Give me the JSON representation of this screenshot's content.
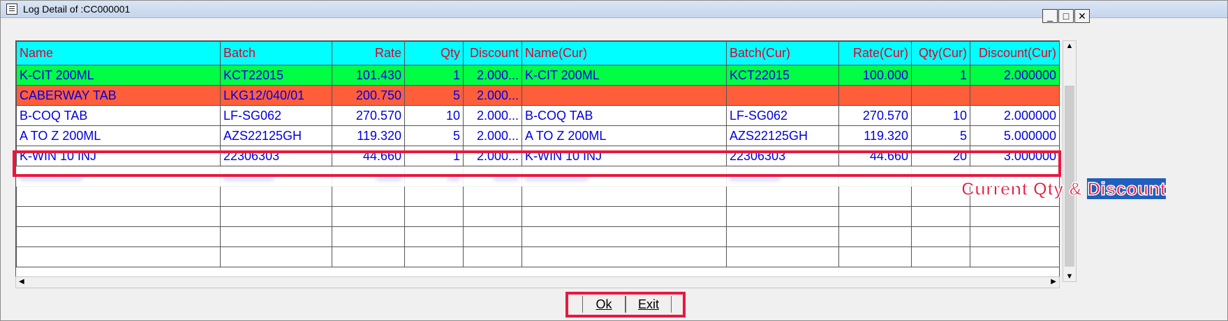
{
  "window": {
    "title": "Log Detail of :CC000001"
  },
  "window_buttons": {
    "minimize": "_",
    "maximize": "□",
    "close": "✕"
  },
  "columns": [
    "Name",
    "Batch",
    "Rate",
    "Qty",
    "Discount",
    "Name(Cur)",
    "Batch(Cur)",
    "Rate(Cur)",
    "Qty(Cur)",
    "Discount(Cur)"
  ],
  "rows": [
    [
      "K-CIT 200ML",
      "KCT22015",
      "101.430",
      "1",
      "2.000...",
      "K-CIT 200ML",
      "KCT22015",
      "100.000",
      "1",
      "2.000000"
    ],
    [
      "CABERWAY TAB",
      "LKG12/040/01",
      "200.750",
      "5",
      "2.000...",
      "",
      "",
      "",
      "",
      ""
    ],
    [
      "B-COQ TAB",
      "LF-SG062",
      "270.570",
      "10",
      "2.000...",
      "B-COQ TAB",
      "LF-SG062",
      "270.570",
      "10",
      "2.000000"
    ],
    [
      "A TO Z 200ML",
      "AZS22125GH",
      "119.320",
      "5",
      "2.000...",
      "A TO Z 200ML",
      "AZS22125GH",
      "119.320",
      "5",
      "5.000000"
    ],
    [
      "K-WIN 10 INJ",
      "22306303",
      "44.660",
      "1",
      "2.000...",
      "K-WIN 10 INJ",
      "22306303",
      "44.660",
      "20",
      "3.000000"
    ]
  ],
  "row_colors": [
    "#00ff44",
    "#ff5e3a",
    "#ffffff",
    "#ffffff",
    "#ffffff"
  ],
  "annotation": {
    "part1": "Current Qty & ",
    "part2": "Discount"
  },
  "buttons": {
    "ok": "Ok",
    "exit": "Exit"
  },
  "colors": {
    "header_bg": "#00ffff",
    "header_text": "#e0002a",
    "cell_text": "#0000e0",
    "highlight_box": "#e8183e"
  }
}
